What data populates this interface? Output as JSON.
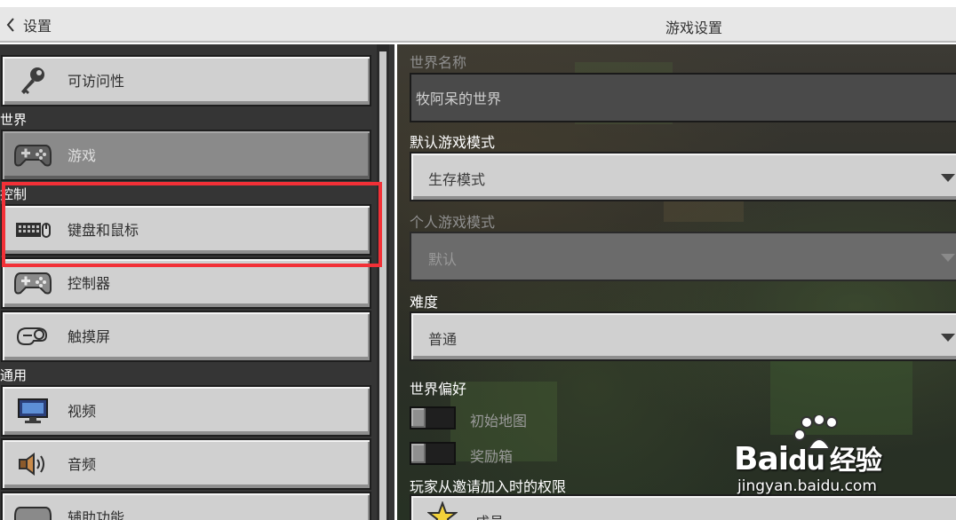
{
  "header": {
    "back_label": "设置",
    "title": "游戏设置"
  },
  "sidebar": {
    "sections": {
      "world": "世界",
      "controls": "控制",
      "general": "通用"
    },
    "items": [
      {
        "label": "可访问性",
        "icon": "key-icon"
      },
      {
        "label": "游戏",
        "icon": "gamepad-icon"
      },
      {
        "label": "键盘和鼠标",
        "icon": "keyboard-mouse-icon"
      },
      {
        "label": "控制器",
        "icon": "controller-icon"
      },
      {
        "label": "触摸屏",
        "icon": "touch-hand-icon"
      },
      {
        "label": "视频",
        "icon": "monitor-icon"
      },
      {
        "label": "音频",
        "icon": "speaker-icon"
      },
      {
        "label": "辅助功能",
        "icon": "controller-icon"
      }
    ]
  },
  "settings": {
    "world_name": {
      "label": "世界名称",
      "value": "牧阿呆的世界"
    },
    "default_game_mode": {
      "label": "默认游戏模式",
      "value": "生存模式"
    },
    "personal_game_mode": {
      "label": "个人游戏模式",
      "value": "默认"
    },
    "difficulty": {
      "label": "难度",
      "value": "普通"
    },
    "world_preferences": {
      "label": "世界偏好"
    },
    "starting_map": {
      "label": "初始地图",
      "on": false
    },
    "bonus_chest": {
      "label": "奖励箱",
      "on": false
    },
    "invite_permissions": {
      "label": "玩家从邀请加入时的权限",
      "value": "成员"
    }
  },
  "watermark": {
    "brand": "Bai",
    "brand2": "du",
    "brand3": "经验",
    "url": "jingyan.baidu.com"
  },
  "colors": {
    "highlight": "#f23037",
    "panel": "#353535",
    "button": "#d0d0d0"
  }
}
